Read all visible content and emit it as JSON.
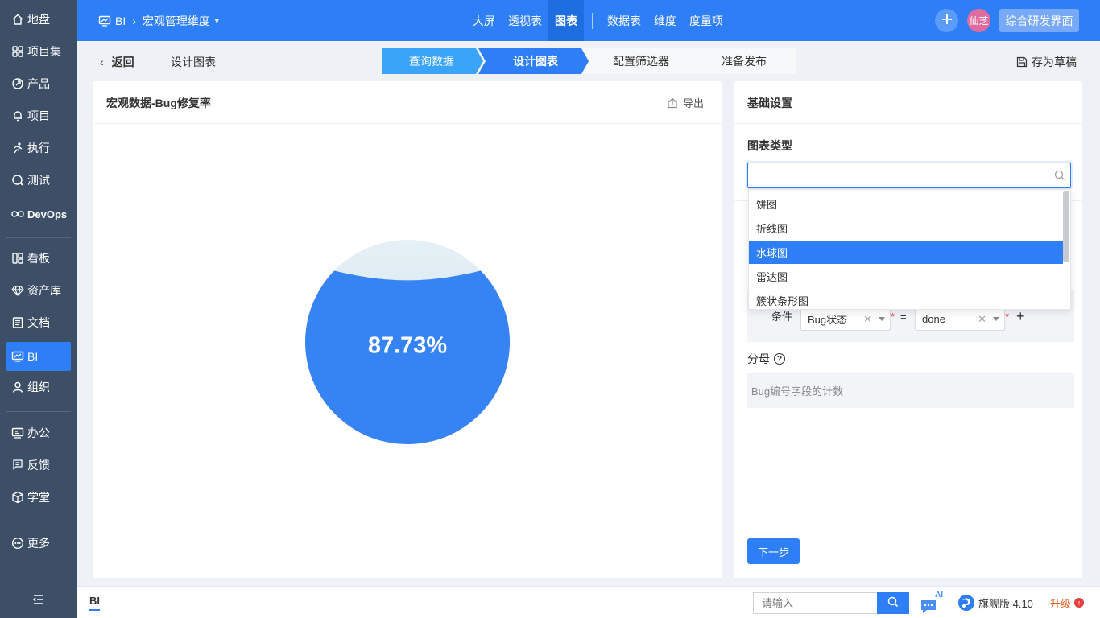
{
  "sidebar": {
    "items": [
      {
        "label": "地盘",
        "icon": "home-icon"
      },
      {
        "label": "项目集",
        "icon": "grid-icon"
      },
      {
        "label": "产品",
        "icon": "product-icon"
      },
      {
        "label": "项目",
        "icon": "bell-icon"
      },
      {
        "label": "执行",
        "icon": "run-icon"
      },
      {
        "label": "测试",
        "icon": "test-icon"
      },
      {
        "label": "DevOps",
        "icon": "infinity-icon"
      },
      {
        "label": "看板",
        "icon": "kanban-icon"
      },
      {
        "label": "资产库",
        "icon": "diamond-icon"
      },
      {
        "label": "文档",
        "icon": "doc-icon"
      },
      {
        "label": "BI",
        "icon": "monitor-icon"
      },
      {
        "label": "组织",
        "icon": "user-icon"
      },
      {
        "label": "办公",
        "icon": "office-icon"
      },
      {
        "label": "反馈",
        "icon": "feedback-icon"
      },
      {
        "label": "学堂",
        "icon": "cube-icon"
      },
      {
        "label": "更多",
        "icon": "more-icon"
      }
    ],
    "active": "BI"
  },
  "header": {
    "module": "BI",
    "dimension": "宏观管理维度",
    "tabs": [
      "大屏",
      "透视表",
      "图表",
      "数据表",
      "维度",
      "度量项"
    ],
    "active_tab": "图表",
    "avatar": "仙芝",
    "workspace": "综合研发界面"
  },
  "toolbar": {
    "back": "返回",
    "subtitle": "设计图表",
    "steps": [
      "查询数据",
      "设计图表",
      "配置筛选器",
      "准备发布"
    ],
    "current_step": 1,
    "save_draft": "存为草稿"
  },
  "chart_panel": {
    "title": "宏观数据-Bug修复率",
    "export": "导出"
  },
  "chart_data": {
    "type": "liquid-fill",
    "value_label": "87.73%",
    "value": 0.8773,
    "fill_color": "#3683f4",
    "empty_color": "#dbe9f1"
  },
  "settings": {
    "title": "基础设置",
    "chart_type_label": "图表类型",
    "chart_type_value": "",
    "dropdown_options": [
      "饼图",
      "折线图",
      "水球图",
      "雷达图",
      "簇状条形图"
    ],
    "dropdown_selected": "水球图",
    "condition_label": "条件",
    "condition_field": "Bug状态",
    "condition_op": "=",
    "condition_value": "done",
    "denominator_label": "分母",
    "denominator_value": "Bug编号字段的计数",
    "next": "下一步"
  },
  "footer": {
    "tab": "BI",
    "search_placeholder": "请输入",
    "ai_badge": "AI",
    "edition": "旗舰版 4.10",
    "upgrade": "升级"
  },
  "colors": {
    "primary": "#2e7ff6",
    "sidebar": "#3d4f66",
    "step_done": "#3aa5f8"
  }
}
